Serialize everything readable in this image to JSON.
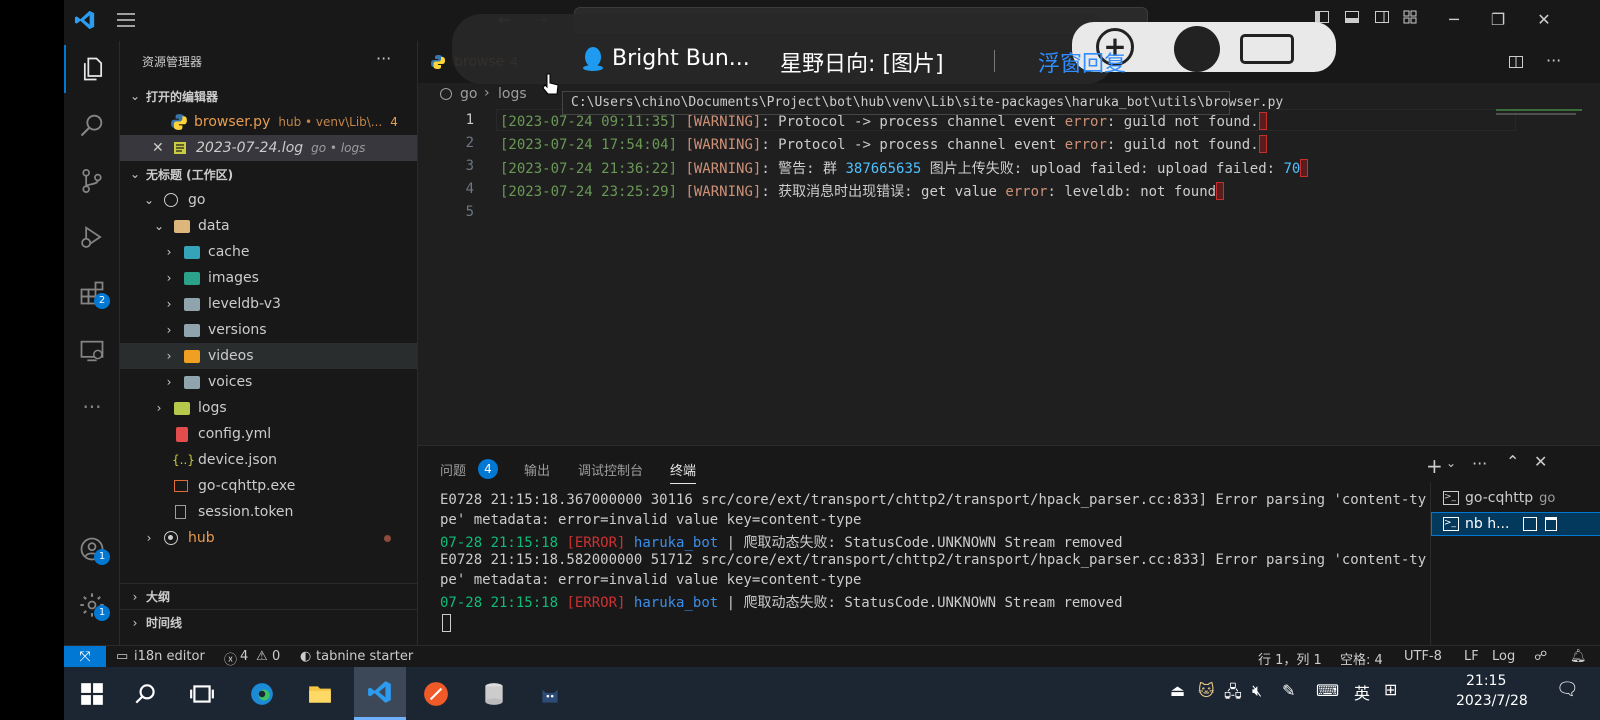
{
  "colors": {
    "accent": "#0078d4",
    "bg": "#1f1f1f",
    "sidebar": "#181818"
  },
  "overlay": {
    "chat_name": "Bright Bun...",
    "chat_message": "星野日向: [图片]",
    "action": "浮窗回复"
  },
  "sidebar": {
    "title": "资源管理器",
    "open_editors": "打开的编辑器",
    "open_files": [
      {
        "name": "browser.py",
        "desc": "hub • venv\\Lib\\...",
        "problems": "4",
        "icon": "python-icon"
      },
      {
        "name": "2023-07-24.log",
        "desc": "go • logs",
        "icon": "log-file-icon"
      }
    ],
    "workspace": "无标题 (工作区)",
    "tree": [
      {
        "name": "go",
        "icon": "root-folder-icon"
      },
      {
        "name": "data",
        "icon": "folder-open-icon"
      },
      {
        "name": "cache",
        "icon": "folder-icon"
      },
      {
        "name": "images",
        "icon": "folder-icon"
      },
      {
        "name": "leveldb-v3",
        "icon": "folder-icon"
      },
      {
        "name": "versions",
        "icon": "folder-icon"
      },
      {
        "name": "videos",
        "icon": "folder-icon"
      },
      {
        "name": "voices",
        "icon": "folder-icon"
      },
      {
        "name": "logs",
        "icon": "folder-icon"
      },
      {
        "name": "config.yml",
        "icon": "yaml-icon"
      },
      {
        "name": "device.json",
        "icon": "json-icon"
      },
      {
        "name": "go-cqhttp.exe",
        "icon": "exe-icon"
      },
      {
        "name": "session.token",
        "icon": "file-icon"
      },
      {
        "name": "hub",
        "icon": "root-folder-icon"
      }
    ],
    "outline": "大纲",
    "timeline": "时间线"
  },
  "activity_badges": {
    "extensions": "2",
    "accounts": "1",
    "settings": "1"
  },
  "editor": {
    "tab_name": "browse",
    "tab_badge": "4",
    "breadcrumb": [
      "go",
      "logs"
    ],
    "tooltip": "C:\\Users\\chino\\Documents\\Project\\bot\\hub\\venv\\Lib\\site-packages\\haruka_bot\\utils\\browser.py",
    "line_numbers": [
      "1",
      "2",
      "3",
      "4",
      "5"
    ],
    "lines": [
      {
        "ts": "[2023-07-24 09:11:35]",
        "level": "[WARNING]",
        "a": ": Protocol -> process channel event ",
        "b": "error",
        "c": ": guild not found."
      },
      {
        "ts": "[2023-07-24 17:54:04]",
        "level": "[WARNING]",
        "a": ": Protocol -> process channel event ",
        "b": "error",
        "c": ": guild not found."
      },
      {
        "ts": "[2023-07-24 21:36:22]",
        "level": "[WARNING]",
        "a": ": 警告: 群 ",
        "num": "387665635",
        "c2": " 图片上传失败: upload failed: upload failed: ",
        "num2": "70"
      },
      {
        "ts": "[2023-07-24 23:25:29]",
        "level": "[WARNING]",
        "a": ": 获取消息时出现错误: get value ",
        "b": "error",
        "c": ": leveldb: not found"
      }
    ]
  },
  "panel": {
    "tabs": [
      "问题",
      "输出",
      "调试控制台",
      "终端"
    ],
    "problems_count": "4",
    "terminal_lines": [
      "E0728 21:15:18.367000000 30116 src/core/ext/transport/chttp2/transport/hpack_parser.cc:833] Error parsing 'content-ty",
      "pe' metadata: error=invalid value key=content-type",
      "E0728 21:15:18.582000000 51712 src/core/ext/transport/chttp2/transport/hpack_parser.cc:833] Error parsing 'content-ty",
      "pe' metadata: error=invalid value key=content-type"
    ],
    "error_line": {
      "time": "07-28 21:15:18",
      "level": "[ERROR]",
      "name": "haruka_bot",
      "sep": " | ",
      "msg": "爬取动态失败: StatusCode.UNKNOWN Stream removed"
    },
    "terminals": [
      {
        "label": "go-cqhttp",
        "desc": "go"
      },
      {
        "label": "nb h..."
      }
    ]
  },
  "statusbar": {
    "i18n": "i18n editor",
    "errors": "4",
    "warnings": "0",
    "tabnine": "tabnine starter",
    "position": "行 1，列 1",
    "spaces": "空格: 4",
    "encoding": "UTF-8",
    "eol": "LF",
    "language": "Log"
  },
  "taskbar": {
    "ime": "英",
    "time": "21:15",
    "date": "2023/7/28"
  }
}
